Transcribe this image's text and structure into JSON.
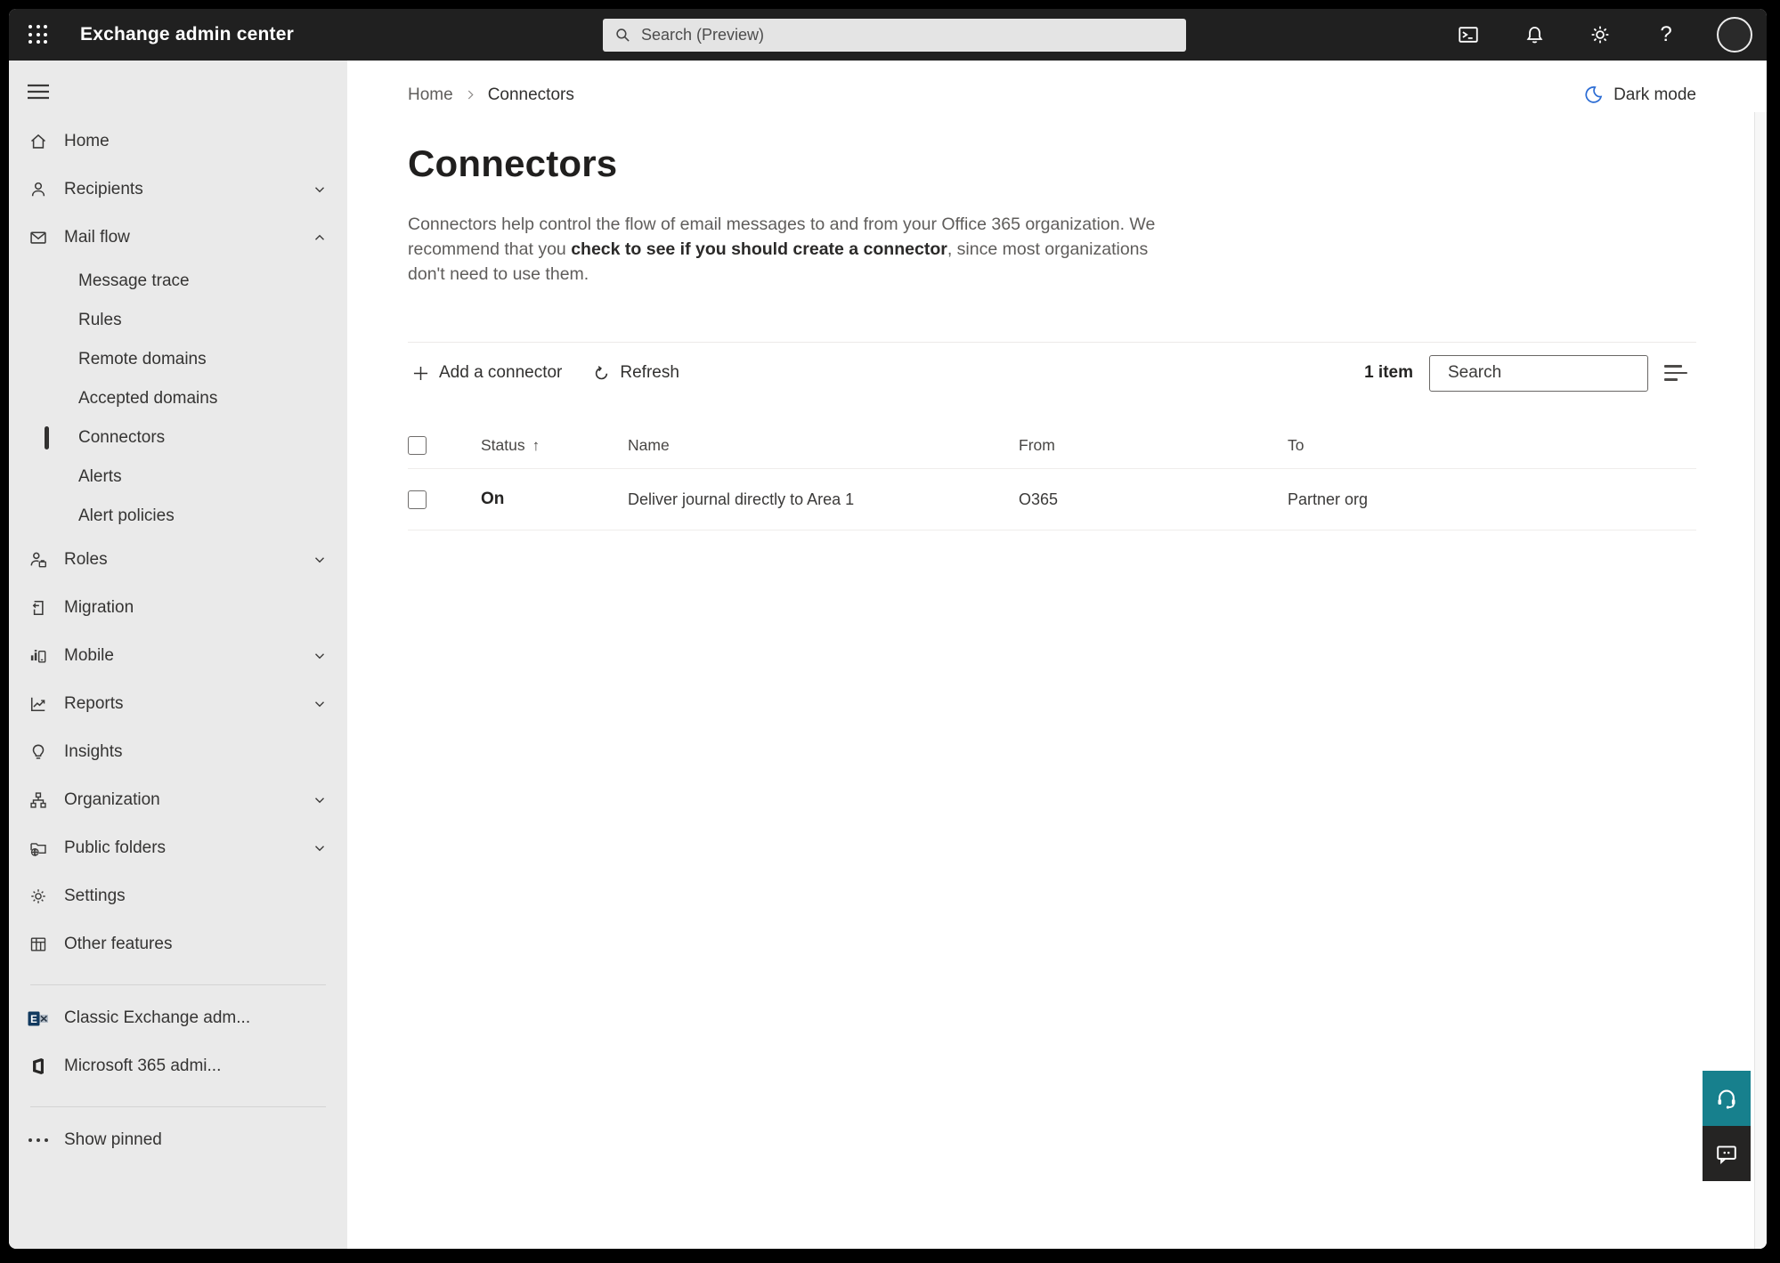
{
  "topbar": {
    "app_title": "Exchange admin center",
    "search_placeholder": "Search (Preview)"
  },
  "sidebar": {
    "items": [
      {
        "label": "Home"
      },
      {
        "label": "Recipients"
      },
      {
        "label": "Mail flow"
      },
      {
        "label": "Roles"
      },
      {
        "label": "Migration"
      },
      {
        "label": "Mobile"
      },
      {
        "label": "Reports"
      },
      {
        "label": "Insights"
      },
      {
        "label": "Organization"
      },
      {
        "label": "Public folders"
      },
      {
        "label": "Settings"
      },
      {
        "label": "Other features"
      }
    ],
    "mail_flow_children": [
      {
        "label": "Message trace"
      },
      {
        "label": "Rules"
      },
      {
        "label": "Remote domains"
      },
      {
        "label": "Accepted domains"
      },
      {
        "label": "Connectors",
        "selected": true
      },
      {
        "label": "Alerts"
      },
      {
        "label": "Alert policies"
      }
    ],
    "footer_items": [
      {
        "label": "Classic Exchange adm..."
      },
      {
        "label": "Microsoft 365 admi..."
      }
    ],
    "show_pinned_label": "Show pinned"
  },
  "breadcrumb": {
    "home": "Home",
    "current": "Connectors"
  },
  "dark_mode_label": "Dark mode",
  "page": {
    "title": "Connectors",
    "description_pre": "Connectors help control the flow of email messages to and from your Office 365 organization. We recommend that you ",
    "description_link": "check to see if you should create a connector",
    "description_post": ", since most organizations don't need to use them."
  },
  "toolbar": {
    "add_label": "Add a connector",
    "refresh_label": "Refresh",
    "item_count": "1 item",
    "search_placeholder": "Search"
  },
  "table": {
    "headers": {
      "status": "Status",
      "name": "Name",
      "from": "From",
      "to": "To"
    },
    "sort_indicator": "↑",
    "rows": [
      {
        "status": "On",
        "name": "Deliver journal directly to Area 1",
        "from": "O365",
        "to": "Partner org"
      }
    ]
  },
  "colors": {
    "topbar_bg": "#202020",
    "sidebar_bg": "#EAEAEA",
    "selected_indicator": "#323130",
    "help_button_teal": "#17808D",
    "feedback_button_dark": "#252423",
    "dark_mode_moon_blue": "#2B6CD4"
  }
}
